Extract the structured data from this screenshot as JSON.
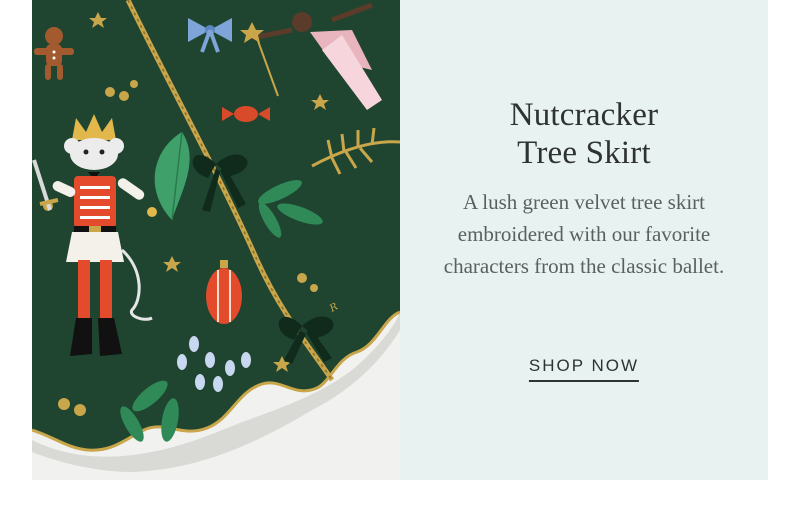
{
  "product": {
    "title_line1": "Nutcracker",
    "title_line2": "Tree Skirt",
    "description": "A lush green velvet tree skirt embroidered with our favorite characters from the classic ballet.",
    "cta_label": "SHOP NOW"
  },
  "colors": {
    "panel_background": "#e8f2f0",
    "velvet_green": "#1f4530",
    "text_dark": "#2f3233",
    "text_muted": "#5b5f60",
    "gold_trim": "#c9a64a"
  },
  "image": {
    "subject": "green velvet Nutcracker tree skirt with embroidered mouse king, ballerina, gingerbread man, ornaments, holly and bows"
  }
}
